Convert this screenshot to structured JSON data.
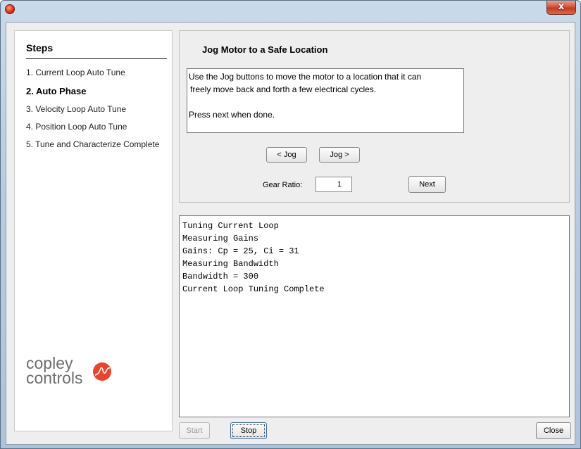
{
  "steps": {
    "title": "Steps",
    "items": [
      {
        "label": "1. Current Loop Auto Tune",
        "current": false
      },
      {
        "label": "2. Auto Phase",
        "current": true
      },
      {
        "label": "3. Velocity Loop Auto Tune",
        "current": false
      },
      {
        "label": "4. Position Loop Auto Tune",
        "current": false
      },
      {
        "label": "5. Tune and Characterize Complete",
        "current": false
      }
    ]
  },
  "logo": {
    "line1": "copley",
    "line2": "controls"
  },
  "jog": {
    "title": "Jog Motor to a Safe Location",
    "instructions": [
      "Use the Jog buttons to move the motor to a location that it can",
      "freely move back and forth a few electrical cycles.",
      "",
      "Press next when done."
    ],
    "jog_back_label": "< Jog",
    "jog_forward_label": "Jog >",
    "gear_ratio_label": "Gear Ratio:",
    "gear_ratio_value": "1",
    "next_label": "Next"
  },
  "log": {
    "lines": [
      "Tuning Current Loop",
      "Measuring Gains",
      "Gains: Cp = 25, Ci = 31",
      "Measuring Bandwidth",
      "Bandwidth = 300",
      "Current Loop Tuning Complete"
    ]
  },
  "footer": {
    "start_label": "Start",
    "stop_label": "Stop",
    "close_label": "Close"
  },
  "titlebar": {
    "close_glyph": "x"
  },
  "colors": {
    "logo_accent": "#e8452c",
    "logo_text": "#6d6e71",
    "window_frame": "#b9cde0"
  }
}
